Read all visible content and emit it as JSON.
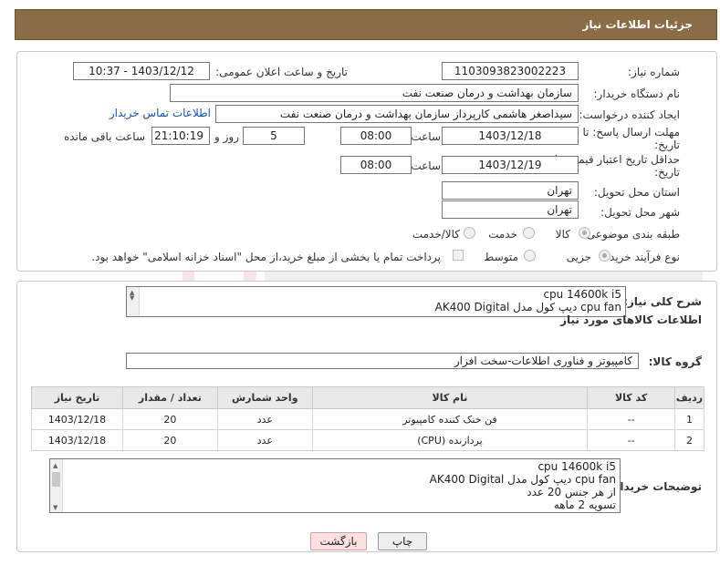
{
  "header": {
    "title": "جزئیات اطلاعات نیاز"
  },
  "need_number": {
    "label": "شماره نیاز:",
    "value": "1103093823002223"
  },
  "announce_datetime": {
    "label": "تاریخ و ساعت اعلان عمومی:",
    "value": "1403/12/12 - 10:37"
  },
  "buyer_org": {
    "label": "نام دستگاه خریدار:",
    "value": "سازمان بهداشت و درمان صنعت نفت"
  },
  "requester": {
    "label": "ایجاد کننده درخواست:",
    "value": "سیداصغر هاشمی کارپرداز سازمان بهداشت و درمان صنعت نفت",
    "contact_link": "اطلاعات تماس خریدار"
  },
  "reply_deadline": {
    "label_line1": "مهلت ارسال پاسخ: تا",
    "label_line2": "تاریخ:",
    "date": "1403/12/18",
    "time_label": "ساعت",
    "time": "08:00",
    "days": "5",
    "days_label": "روز و",
    "remaining": "21:10:19",
    "remaining_label": "ساعت باقی مانده"
  },
  "price_validity": {
    "label_line1": "حداقل تاریخ اعتبار قیمت: تا",
    "label_line2": "تاریخ:",
    "date": "1403/12/19",
    "time_label": "ساعت",
    "time": "08:00"
  },
  "delivery_province": {
    "label": "استان محل تحویل:",
    "value": "تهران"
  },
  "delivery_city": {
    "label": "شهر محل تحویل:",
    "value": "تهران"
  },
  "category": {
    "label": "طبقه بندی موضوعی:",
    "options": [
      "کالا",
      "خدمت",
      "کالا/خدمت"
    ],
    "selected": "کالا"
  },
  "process_type": {
    "label": "نوع فرآیند خرید :",
    "options": [
      "جزیی",
      "متوسط"
    ],
    "selected": "جزیی",
    "payment_note": "پرداخت تمام یا بخشی از مبلغ خرید،از محل \"اسناد خزانه اسلامی\" خواهد بود."
  },
  "need_summary": {
    "label": "شرح کلی نیاز:",
    "lines": [
      "cpu 14600k i5",
      "cpu fan دیپ کول مدل AK400 Digital"
    ]
  },
  "goods_section": {
    "title": "اطلاعات کالاهای مورد نیاز"
  },
  "goods_group": {
    "label": "گروه کالا:",
    "value": "کامپیوتر و فناوری اطلاعات-سخت افزار"
  },
  "table": {
    "headers": [
      "ردیف",
      "کد کالا",
      "نام کالا",
      "واحد شمارش",
      "تعداد / مقدار",
      "تاریخ نیاز"
    ],
    "rows": [
      [
        "1",
        "--",
        "فن خنک کننده کامپیوتر",
        "عدد",
        "20",
        "1403/12/18"
      ],
      [
        "2",
        "--",
        "پردازنده (CPU)",
        "عدد",
        "20",
        "1403/12/18"
      ]
    ]
  },
  "buyer_notes": {
    "label": "توضیحات خریدار:",
    "lines": [
      "cpu 14600k i5",
      "cpu fan دیپ کول مدل AK400 Digital",
      "از هر جنس 20 عدد",
      "تسویه 2 ماهه"
    ]
  },
  "buttons": {
    "print": "چاپ",
    "back": "بازگشت"
  }
}
